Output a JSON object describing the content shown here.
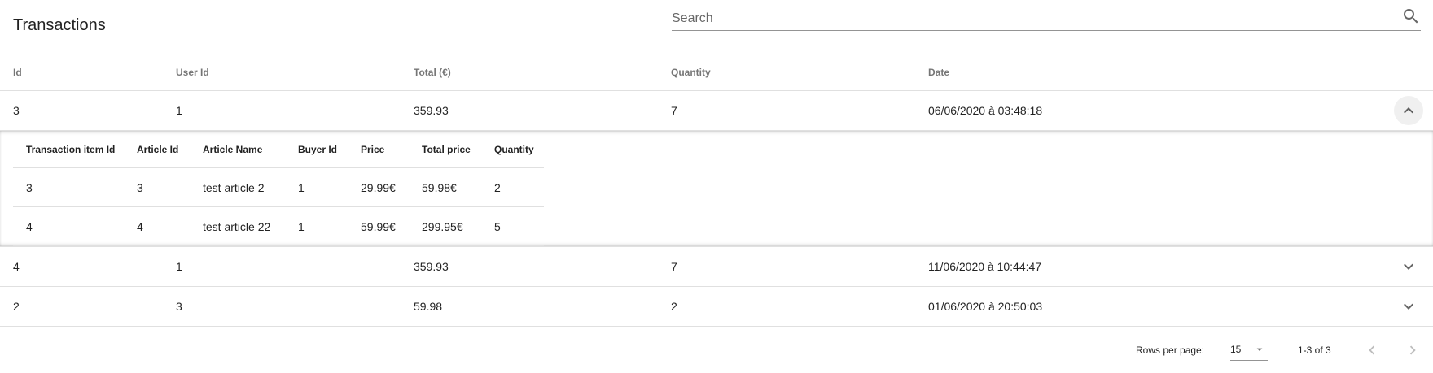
{
  "header": {
    "title": "Transactions",
    "search_placeholder": "Search",
    "search_value": ""
  },
  "columns": [
    "Id",
    "User Id",
    "Total (€)",
    "Quantity",
    "Date"
  ],
  "rows": [
    {
      "id": "3",
      "user_id": "1",
      "total": "359.93",
      "quantity": "7",
      "date": "06/06/2020 à 03:48:18",
      "expanded": true
    },
    {
      "id": "4",
      "user_id": "1",
      "total": "359.93",
      "quantity": "7",
      "date": "11/06/2020 à 10:44:47",
      "expanded": false
    },
    {
      "id": "2",
      "user_id": "3",
      "total": "59.98",
      "quantity": "2",
      "date": "01/06/2020 à 20:50:03",
      "expanded": false
    }
  ],
  "detail": {
    "columns": [
      "Transaction item Id",
      "Article Id",
      "Article Name",
      "Buyer Id",
      "Price",
      "Total price",
      "Quantity"
    ],
    "items": [
      {
        "item_id": "3",
        "article_id": "3",
        "article_name": "test article 2",
        "buyer_id": "1",
        "price": "29.99€",
        "total_price": "59.98€",
        "quantity": "2"
      },
      {
        "item_id": "4",
        "article_id": "4",
        "article_name": "test article 22",
        "buyer_id": "1",
        "price": "59.99€",
        "total_price": "299.95€",
        "quantity": "5"
      }
    ]
  },
  "footer": {
    "rows_per_page_label": "Rows per page:",
    "rows_per_page_value": "15",
    "range_label": "1-3 of 3"
  },
  "icons": {
    "search": "search-icon",
    "collapse": "chevron-up-icon",
    "expand": "chevron-down-icon",
    "dropdown": "arrow-drop-down-icon",
    "prev": "chevron-left-icon",
    "next": "chevron-right-icon"
  }
}
